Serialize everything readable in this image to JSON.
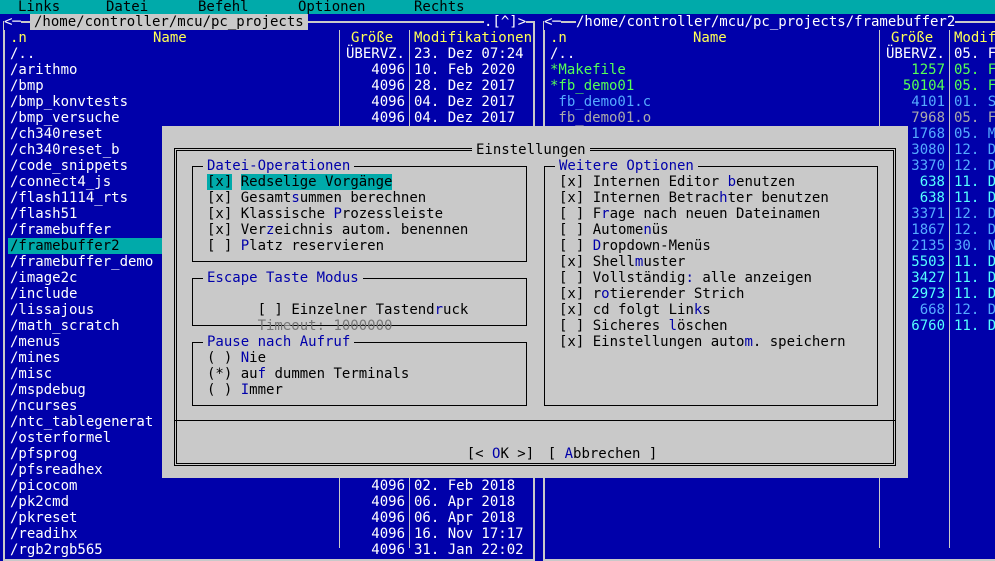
{
  "menu": [
    "Links",
    "Datei",
    "Befehl",
    "Optionen",
    "Rechts"
  ],
  "left_panel": {
    "path": "/home/controller/mcu/pc_projects",
    "corner": "<─",
    "right_marks": ".[^]>",
    "col_name": ".n",
    "col_name2": "Name",
    "col_size": "Größe",
    "col_mod": "Modifikationen",
    "rows": [
      {
        "name": "/..",
        "size": "ÜBERVZ.",
        "mod": "23. Dez 07:24"
      },
      {
        "name": "/arithmo",
        "size": "4096",
        "mod": "10. Feb 2020"
      },
      {
        "name": "/bmp",
        "size": "4096",
        "mod": "28. Dez 2017"
      },
      {
        "name": "/bmp_konvtests",
        "size": "4096",
        "mod": "04. Dez 2017"
      },
      {
        "name": "/bmp_versuche",
        "size": "4096",
        "mod": "04. Dez 2017"
      },
      {
        "name": "/ch340reset",
        "size": "",
        "mod": ""
      },
      {
        "name": "/ch340reset_b",
        "size": "",
        "mod": ""
      },
      {
        "name": "/code_snippets",
        "size": "",
        "mod": ""
      },
      {
        "name": "/connect4_js",
        "size": "",
        "mod": ""
      },
      {
        "name": "/flash1114_rts",
        "size": "",
        "mod": ""
      },
      {
        "name": "/flash51",
        "size": "",
        "mod": ""
      },
      {
        "name": "/framebuffer",
        "size": "",
        "mod": ""
      },
      {
        "name": "/framebuffer2",
        "size": "",
        "mod": ""
      },
      {
        "name": "/framebuffer_demo",
        "size": "",
        "mod": ""
      },
      {
        "name": "/image2c",
        "size": "",
        "mod": ""
      },
      {
        "name": "/include",
        "size": "",
        "mod": ""
      },
      {
        "name": "/lissajous",
        "size": "",
        "mod": ""
      },
      {
        "name": "/math_scratch",
        "size": "",
        "mod": ""
      },
      {
        "name": "/menus",
        "size": "",
        "mod": ""
      },
      {
        "name": "/mines",
        "size": "",
        "mod": ""
      },
      {
        "name": "/misc",
        "size": "",
        "mod": ""
      },
      {
        "name": "/mspdebug",
        "size": "",
        "mod": ""
      },
      {
        "name": "/ncurses",
        "size": "",
        "mod": ""
      },
      {
        "name": "/ntc_tablegenerat",
        "size": "",
        "mod": ""
      },
      {
        "name": "/osterformel",
        "size": "",
        "mod": ""
      },
      {
        "name": "/pfsprog",
        "size": "",
        "mod": ""
      },
      {
        "name": "/pfsreadhex",
        "size": "",
        "mod": ""
      },
      {
        "name": "/picocom",
        "size": "4096",
        "mod": "02. Feb 2018"
      },
      {
        "name": "/pk2cmd",
        "size": "4096",
        "mod": "06. Apr 2018"
      },
      {
        "name": "/pkreset",
        "size": "4096",
        "mod": "06. Apr 2018"
      },
      {
        "name": "/readihx",
        "size": "4096",
        "mod": "16. Nov 17:17"
      },
      {
        "name": "/rgb2rgb565",
        "size": "4096",
        "mod": "31. Jan 22:02"
      }
    ],
    "selected_index": 12
  },
  "right_panel": {
    "path": "/home/controller/mcu/pc_projects/framebuffer2",
    "corner": "<─",
    "col_name": ".n",
    "col_name2": "Name",
    "col_size": "Größe",
    "col_mod": "Modif",
    "rows": [
      {
        "name": "/..",
        "size": "ÜBERVZ.",
        "mod": "05. F",
        "color": "#ffffff"
      },
      {
        "name": "*Makefile",
        "size": "1257",
        "mod": "05. F",
        "color": "#55ff55"
      },
      {
        "name": "*fb_demo01",
        "size": "50104",
        "mod": "05. F",
        "color": "#55ff55"
      },
      {
        "name": " fb_demo01.c",
        "size": "4101",
        "mod": "01. S",
        "color": "#55aaff"
      },
      {
        "name": " fb_demo01.o",
        "size": "7968",
        "mod": "05. F",
        "color": "#aaaaaa"
      },
      {
        "name": "",
        "size": "1768",
        "mod": "05. M",
        "color": "#55aaff"
      },
      {
        "name": "",
        "size": "3080",
        "mod": "12. D",
        "color": "#55aaff"
      },
      {
        "name": "",
        "size": "3370",
        "mod": "12. D",
        "color": "#55aaff"
      },
      {
        "name": "",
        "size": "638",
        "mod": "11. D",
        "color": "#55ffff"
      },
      {
        "name": "",
        "size": "638",
        "mod": "11. D",
        "color": "#55ffff"
      },
      {
        "name": "",
        "size": "3371",
        "mod": "12. D",
        "color": "#55aaff"
      },
      {
        "name": "",
        "size": "1867",
        "mod": "12. D",
        "color": "#55aaff"
      },
      {
        "name": "",
        "size": "2135",
        "mod": "30. N",
        "color": "#55aaff"
      },
      {
        "name": "",
        "size": "5503",
        "mod": "11. D",
        "color": "#55ffff"
      },
      {
        "name": "",
        "size": "3427",
        "mod": "11. D",
        "color": "#55ffff"
      },
      {
        "name": "",
        "size": "2973",
        "mod": "11. D",
        "color": "#55ffff"
      },
      {
        "name": "",
        "size": "668",
        "mod": "12. D",
        "color": "#55aaff"
      },
      {
        "name": "",
        "size": "6760",
        "mod": "11. D",
        "color": "#55ffff"
      }
    ]
  },
  "dialog": {
    "title": "Einstellungen",
    "file_ops": {
      "title": "Datei-Operationen",
      "options": [
        {
          "box": "[x]",
          "pre": "",
          "hot": "R",
          "post": "edselige Vorgänge",
          "focus": true
        },
        {
          "box": "[x]",
          "pre": "Gesamt",
          "hot": "s",
          "post": "ummen berechnen",
          "focus": false
        },
        {
          "box": "[x]",
          "pre": "Klassische ",
          "hot": "P",
          "post": "rozessleiste",
          "focus": false
        },
        {
          "box": "[x]",
          "pre": "Ver",
          "hot": "z",
          "post": "eichnis autom. benennen",
          "focus": false
        },
        {
          "box": "[ ]",
          "pre": "",
          "hot": "P",
          "post": "latz reservieren",
          "focus": false
        }
      ]
    },
    "escape": {
      "title": "Escape Taste Modus",
      "option": {
        "box": "[ ]",
        "pre": "Einzelner Tastend",
        "hot": "r",
        "post": "uck"
      },
      "timeout_label": "Timeout:",
      "timeout_value": "1000000"
    },
    "pause": {
      "title": "Pause nach Aufruf",
      "options": [
        {
          "box": "( )",
          "pre": "",
          "hot": "N",
          "post": "ie"
        },
        {
          "box": "(*)",
          "pre": "au",
          "hot": "f",
          "post": " dummen Terminals"
        },
        {
          "box": "( )",
          "pre": "",
          "hot": "I",
          "post": "mmer"
        }
      ]
    },
    "further": {
      "title": "Weitere Optionen",
      "options": [
        {
          "box": "[x]",
          "pre": "Internen Editor ",
          "hot": "b",
          "post": "enutzen"
        },
        {
          "box": "[x]",
          "pre": "Internen Betrac",
          "hot": "h",
          "post": "ter benutzen"
        },
        {
          "box": "[ ]",
          "pre": "F",
          "hot": "r",
          "post": "age nach neuen Dateinamen"
        },
        {
          "box": "[ ]",
          "pre": "Autome",
          "hot": "n",
          "post": "üs"
        },
        {
          "box": "[ ]",
          "pre": "",
          "hot": "D",
          "post": "ropdown-Menüs"
        },
        {
          "box": "[x]",
          "pre": "Shell",
          "hot": "m",
          "post": "uster"
        },
        {
          "box": "[ ]",
          "pre": "Vollständig",
          "hot": ":",
          "post": " alle anzeigen"
        },
        {
          "box": "[x]",
          "pre": "r",
          "hot": "o",
          "post": "tierender Strich"
        },
        {
          "box": "[x]",
          "pre": "cd folgt Lin",
          "hot": "k",
          "post": "s"
        },
        {
          "box": "[ ]",
          "pre": "Sicheres ",
          "hot": "l",
          "post": "öschen"
        },
        {
          "box": "[x]",
          "pre": "Einstellungen auto",
          "hot": "m",
          "post": ". speichern"
        }
      ]
    },
    "ok": {
      "open": "[< ",
      "hot": "O",
      "post": "K >]"
    },
    "cancel": {
      "open": "[ ",
      "hot": "A",
      "post": "bbrechen ]"
    }
  }
}
